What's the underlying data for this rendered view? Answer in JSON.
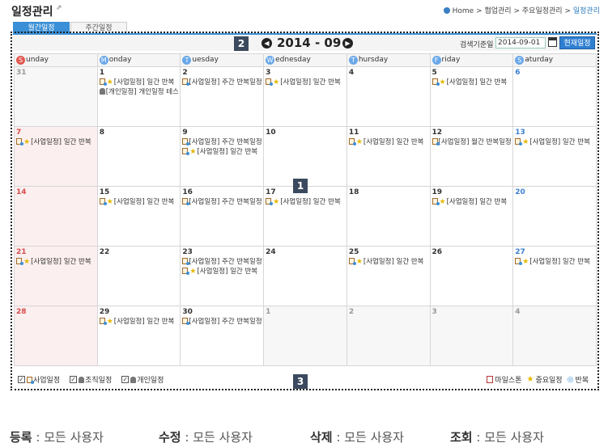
{
  "page": {
    "title": "일정관리",
    "breadcrumb": [
      "Home",
      "협업관리",
      "주요일정관리",
      "일정관리"
    ],
    "breadcrumb_sep": ">"
  },
  "tabs": [
    {
      "label": "월간일정",
      "active": true
    },
    {
      "label": "주간일정",
      "active": false
    }
  ],
  "badges": [
    "1",
    "2",
    "3"
  ],
  "toolbar": {
    "month": "2014 - 09",
    "search_label": "검색기준일",
    "search_date": "2014-09-01",
    "today_button": "현재일정"
  },
  "weekdays": [
    {
      "initial": "S",
      "rest": "unday",
      "color": "#e0574e"
    },
    {
      "initial": "M",
      "rest": "onday",
      "color": "#6aa8e8"
    },
    {
      "initial": "T",
      "rest": "uesday",
      "color": "#6aa8e8"
    },
    {
      "initial": "W",
      "rest": "ednesday",
      "color": "#6aa8e8"
    },
    {
      "initial": "T",
      "rest": "hursday",
      "color": "#6aa8e8"
    },
    {
      "initial": "F",
      "rest": "riday",
      "color": "#6aa8e8"
    },
    {
      "initial": "S",
      "rest": "aturday",
      "color": "#6aa8e8"
    }
  ],
  "weeks": [
    [
      {
        "day": "31",
        "other": true,
        "events": []
      },
      {
        "day": "1",
        "events": [
          {
            "type": "important",
            "text": "[사업일정] 일간 반복"
          },
          {
            "type": "personal",
            "text": "[개인일정] 개인일정 테스트"
          }
        ]
      },
      {
        "day": "2",
        "events": [
          {
            "type": "repeat",
            "text": "[사업일정] 주간 반복일정"
          }
        ]
      },
      {
        "day": "3",
        "events": [
          {
            "type": "important",
            "text": "[사업일정] 일간 반복"
          }
        ]
      },
      {
        "day": "4",
        "events": []
      },
      {
        "day": "5",
        "events": [
          {
            "type": "important",
            "text": "[사업일정] 일간 반복"
          }
        ]
      },
      {
        "day": "6",
        "events": []
      }
    ],
    [
      {
        "day": "7",
        "events": [
          {
            "type": "important",
            "text": "[사업일정] 일간 반복"
          }
        ]
      },
      {
        "day": "8",
        "events": []
      },
      {
        "day": "9",
        "events": [
          {
            "type": "repeat",
            "text": "[사업일정] 주간 반복일정"
          },
          {
            "type": "important",
            "text": "[사업일정] 일간 반복"
          }
        ]
      },
      {
        "day": "10",
        "events": []
      },
      {
        "day": "11",
        "events": [
          {
            "type": "important",
            "text": "[사업일정] 일간 반복"
          }
        ]
      },
      {
        "day": "12",
        "events": [
          {
            "type": "repeat",
            "text": "[사업일정] 월간 반복일정"
          }
        ]
      },
      {
        "day": "13",
        "events": [
          {
            "type": "important",
            "text": "[사업일정] 일간 반복"
          }
        ]
      }
    ],
    [
      {
        "day": "14",
        "events": []
      },
      {
        "day": "15",
        "events": [
          {
            "type": "important",
            "text": "[사업일정] 일간 반복"
          }
        ]
      },
      {
        "day": "16",
        "events": [
          {
            "type": "repeat",
            "text": "[사업일정] 주간 반복일정"
          }
        ]
      },
      {
        "day": "17",
        "events": [
          {
            "type": "important",
            "text": "[사업일정] 일간 반복"
          }
        ]
      },
      {
        "day": "18",
        "events": []
      },
      {
        "day": "19",
        "events": [
          {
            "type": "important",
            "text": "[사업일정] 일간 반복"
          }
        ]
      },
      {
        "day": "20",
        "events": []
      }
    ],
    [
      {
        "day": "21",
        "events": [
          {
            "type": "important",
            "text": "[사업일정] 일간 반복"
          }
        ]
      },
      {
        "day": "22",
        "events": []
      },
      {
        "day": "23",
        "events": [
          {
            "type": "repeat",
            "text": "[사업일정] 주간 반복일정"
          },
          {
            "type": "important",
            "text": "[사업일정] 일간 반복"
          }
        ]
      },
      {
        "day": "24",
        "events": []
      },
      {
        "day": "25",
        "events": [
          {
            "type": "important",
            "text": "[사업일정] 일간 반복"
          }
        ]
      },
      {
        "day": "26",
        "events": []
      },
      {
        "day": "27",
        "events": [
          {
            "type": "important",
            "text": "[사업일정] 일간 반복"
          }
        ]
      }
    ],
    [
      {
        "day": "28",
        "events": []
      },
      {
        "day": "29",
        "events": [
          {
            "type": "important",
            "text": "[사업일정] 일간 반복"
          }
        ]
      },
      {
        "day": "30",
        "events": [
          {
            "type": "repeat",
            "text": "[사업일정] 주간 반복일정"
          }
        ]
      },
      {
        "day": "1",
        "other": true,
        "events": []
      },
      {
        "day": "2",
        "other": true,
        "events": []
      },
      {
        "day": "3",
        "other": true,
        "events": []
      },
      {
        "day": "4",
        "other": true,
        "events": []
      }
    ]
  ],
  "legend": {
    "filters": [
      "사업일정",
      "조직일정",
      "개인일정"
    ],
    "milestone": "마일스톤",
    "important": "중요일정",
    "repeat": "반복"
  },
  "permissions": [
    {
      "label": "등록",
      "value": "모든 사용자"
    },
    {
      "label": "수정",
      "value": "모든 사용자"
    },
    {
      "label": "삭제",
      "value": "모든 사용자"
    },
    {
      "label": "조회",
      "value": "모든 사용자"
    }
  ],
  "colors": {
    "accent": "#3a8fd6",
    "sunday": "#d84b4b",
    "saturday": "#3a7fd1",
    "sunday_bg": "#fcefef"
  }
}
